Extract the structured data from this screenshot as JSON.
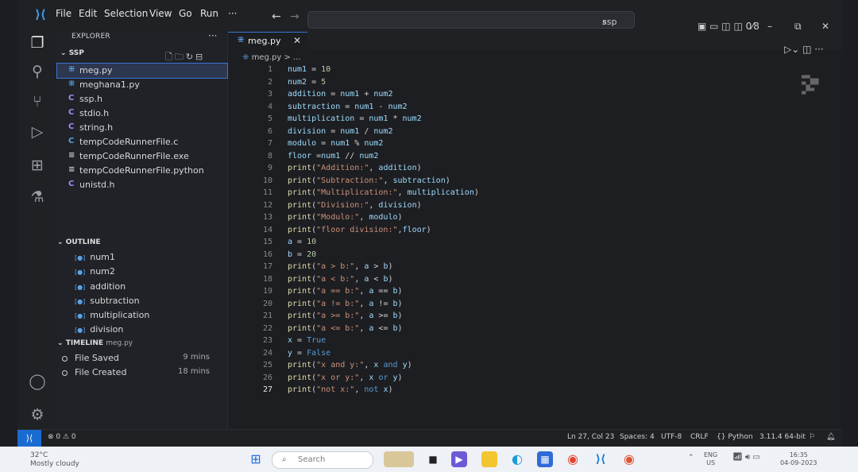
{
  "menu": [
    "File",
    "Edit",
    "Selection",
    "View",
    "Go",
    "Run",
    "···"
  ],
  "search_text": "ssp",
  "explorer": {
    "header": "EXPLORER",
    "folder": "SSP",
    "files": [
      {
        "icon": "python",
        "name": "meg.py",
        "active": true
      },
      {
        "icon": "python",
        "name": "meghana1.py",
        "active": false
      },
      {
        "icon": "c",
        "name": "ssp.h",
        "active": false
      },
      {
        "icon": "c",
        "name": "stdio.h",
        "active": false
      },
      {
        "icon": "c",
        "name": "string.h",
        "active": false
      },
      {
        "icon": "c",
        "name": "tempCodeRunnerFile.c",
        "active": false
      },
      {
        "icon": "list",
        "name": "tempCodeRunnerFile.exe",
        "active": false
      },
      {
        "icon": "list",
        "name": "tempCodeRunnerFile.python",
        "active": false
      },
      {
        "icon": "c",
        "name": "unistd.h",
        "active": false
      }
    ]
  },
  "outline": {
    "title": "OUTLINE",
    "items": [
      "num1",
      "num2",
      "addition",
      "subtraction",
      "multiplication",
      "division"
    ]
  },
  "timeline": {
    "title": "TIMELINE",
    "file": "meg.py",
    "items": [
      {
        "label": "File Saved",
        "time": "9 mins"
      },
      {
        "label": "File Created",
        "time": "18 mins"
      }
    ]
  },
  "tab": {
    "name": "meg.py"
  },
  "breadcrumb": "meg.py > ...",
  "code_lines": [
    "num1 = 10",
    "num2 = 5",
    "addition = num1 + num2",
    "subtraction = num1 - num2",
    "multiplication = num1 * num2",
    "division = num1 / num2",
    "modulo = num1 % num2",
    "floor =num1 // num2",
    "print(\"Addition:\", addition)",
    "print(\"Subtraction:\", subtraction)",
    "print(\"Multiplication:\", multiplication)",
    "print(\"Division:\", division)",
    "print(\"Modulo:\", modulo)",
    "print(\"floor division:\",floor)",
    "a = 10",
    "b = 20",
    "print(\"a > b:\", a > b)",
    "print(\"a < b:\", a < b)",
    "print(\"a == b:\", a == b)",
    "print(\"a != b:\", a != b)",
    "print(\"a >= b:\", a >= b)",
    "print(\"a <= b:\", a <= b)",
    "x = True",
    "y = False",
    "print(\"x and y:\", x and y)",
    "print(\"x or y:\", x or y)",
    "print(\"not x:\", not x)"
  ],
  "status": {
    "problems": "⊗ 0 ⚠ 0",
    "position": "Ln 27, Col 23",
    "spaces": "Spaces: 4",
    "encoding": "UTF-8",
    "eol": "CRLF",
    "language": "Python",
    "interpreter": "3.11.4 64-bit"
  },
  "taskbar": {
    "temp": "32°C",
    "weather": "Mostly cloudy",
    "search": "Search",
    "lang1": "ENG",
    "lang2": "US",
    "time": "16:35",
    "date": "04-09-2023"
  },
  "colors": {
    "accent": "#1a6bd1",
    "keyword": "#569cd6",
    "string": "#ce9178",
    "function": "#dcdcaa",
    "variable": "#9cdcfe",
    "number": "#b5cea8"
  }
}
